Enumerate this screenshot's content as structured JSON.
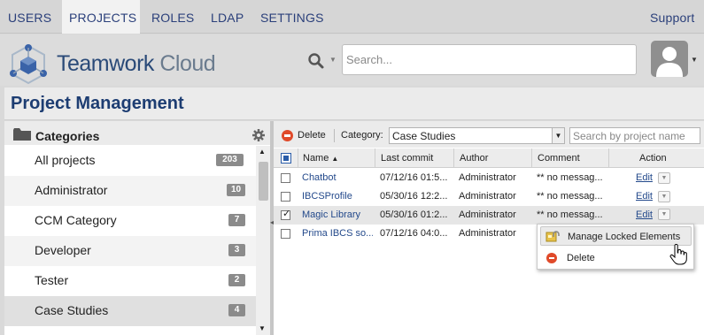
{
  "topnav": {
    "items": [
      {
        "label": "USERS"
      },
      {
        "label": "PROJECTS",
        "active": true
      },
      {
        "label": "ROLES"
      },
      {
        "label": "LDAP"
      },
      {
        "label": "SETTINGS"
      }
    ],
    "support_label": "Support"
  },
  "header": {
    "brand_primary": "Teamwork",
    "brand_secondary": "Cloud",
    "search_placeholder": "Search...",
    "search_icon": "search-icon",
    "avatar_icon": "user-avatar-icon"
  },
  "page": {
    "title": "Project Management"
  },
  "categories": {
    "title": "Categories",
    "items": [
      {
        "label": "All projects",
        "count": "203"
      },
      {
        "label": "Administrator",
        "count": "10"
      },
      {
        "label": "CCM Category",
        "count": "7"
      },
      {
        "label": "Developer",
        "count": "3"
      },
      {
        "label": "Tester",
        "count": "2"
      },
      {
        "label": "Case Studies",
        "count": "4",
        "selected": true
      }
    ]
  },
  "projects": {
    "toolbar": {
      "delete_label": "Delete",
      "category_label": "Category:",
      "category_value": "Case Studies",
      "search_placeholder": "Search by project name"
    },
    "columns": [
      "Name",
      "Last commit",
      "Author",
      "Comment",
      "Action"
    ],
    "rows": [
      {
        "name": "Chatbot",
        "last_commit": "07/12/16 01:5...",
        "author": "Administrator",
        "comment": "** no messag...",
        "action": "Edit",
        "checked": false
      },
      {
        "name": "IBCSProfile",
        "last_commit": "05/30/16 12:2...",
        "author": "Administrator",
        "comment": "** no messag...",
        "action": "Edit",
        "checked": false
      },
      {
        "name": "Magic Library",
        "last_commit": "05/30/16 01:2...",
        "author": "Administrator",
        "comment": "** no messag...",
        "action": "Edit",
        "checked": true
      },
      {
        "name": "Prima IBCS so...",
        "last_commit": "07/12/16 04:0...",
        "author": "Administrator",
        "comment": "",
        "action": "",
        "checked": false
      }
    ]
  },
  "context_menu": {
    "items": [
      {
        "label": "Manage Locked Elements",
        "icon": "lock-icon"
      },
      {
        "label": "Delete",
        "icon": "delete-icon"
      }
    ]
  },
  "colors": {
    "brand_blue": "#1d3d72",
    "link_blue": "#23498b",
    "delete_red": "#e04a2a",
    "badge_gray": "#8b8b8b"
  }
}
